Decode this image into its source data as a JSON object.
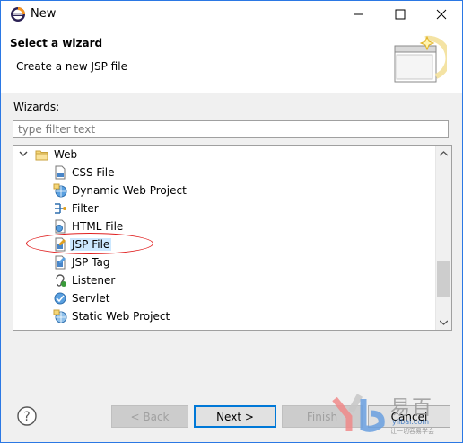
{
  "window": {
    "title": "New"
  },
  "header": {
    "title": "Select a wizard",
    "description": "Create a new JSP file"
  },
  "wizards": {
    "label": "Wizards:",
    "filter_placeholder": "type filter text",
    "tree": {
      "category": "Web",
      "items": [
        {
          "label": "CSS File",
          "icon": "css-file-icon"
        },
        {
          "label": "Dynamic Web Project",
          "icon": "web-project-icon"
        },
        {
          "label": "Filter",
          "icon": "filter-icon"
        },
        {
          "label": "HTML File",
          "icon": "html-file-icon"
        },
        {
          "label": "JSP File",
          "icon": "jsp-file-icon",
          "selected": true
        },
        {
          "label": "JSP Tag",
          "icon": "jsp-tag-icon"
        },
        {
          "label": "Listener",
          "icon": "listener-icon"
        },
        {
          "label": "Servlet",
          "icon": "servlet-icon"
        },
        {
          "label": "Static Web Project",
          "icon": "static-web-project-icon"
        }
      ]
    }
  },
  "buttons": {
    "back": "< Back",
    "next": "Next >",
    "finish": "Finish",
    "cancel": "Cancel"
  },
  "watermark": {
    "text": "易百",
    "sub": "yiibai.com",
    "sub2": "让一切容易学会"
  }
}
